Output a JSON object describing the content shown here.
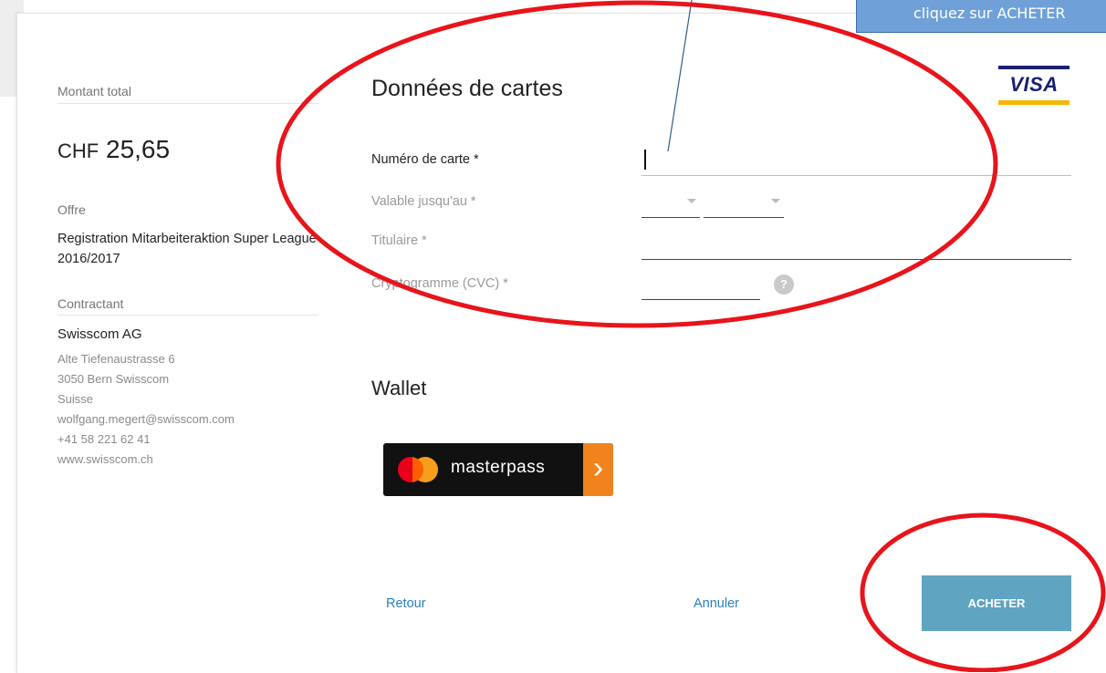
{
  "summary": {
    "total_label": "Montant total",
    "currency": "CHF",
    "amount": "25,65",
    "offer_label": "Offre",
    "offer_text": "Registration Mitarbeiteraktion Super League 2016/2017",
    "contractor_label": "Contractant",
    "company": "Swisscom AG",
    "address_lines": [
      "Alte Tiefenaustrasse 6",
      "3050 Bern Swisscom",
      "Suisse",
      "wolfgang.megert@swisscom.com",
      "+41 58 221 62 41",
      "www.swisscom.ch"
    ]
  },
  "card_form": {
    "title": "Données de cartes",
    "card_number_label": "Numéro de carte *",
    "card_number_value": "",
    "expiry_label": "Valable jusqu'au *",
    "expiry_month_value": "",
    "expiry_year_value": "",
    "holder_label": "Titulaire *",
    "holder_value": "",
    "cvc_label": "Cryptogramme (CVC) *",
    "cvc_value": "",
    "help_glyph": "?",
    "brand_logo_text": "VISA",
    "brand_icon": "visa-logo-icon"
  },
  "wallet": {
    "title": "Wallet",
    "masterpass_label": "masterpass",
    "arrow_glyph": "›"
  },
  "actions": {
    "back": "Retour",
    "cancel": "Annuler",
    "buy": "ACHETER"
  },
  "annotation": {
    "tooltip_text": "cliquez sur ACHETER"
  },
  "colors": {
    "accent_yellow": "#f1c232",
    "link_blue": "#2a7fbf",
    "buy_button": "#5fa4c1",
    "annotation_red": "#e8141b",
    "tooltip_blue": "#6fa0d8",
    "visa_navy": "#1a1f71",
    "visa_gold": "#f7b600"
  }
}
